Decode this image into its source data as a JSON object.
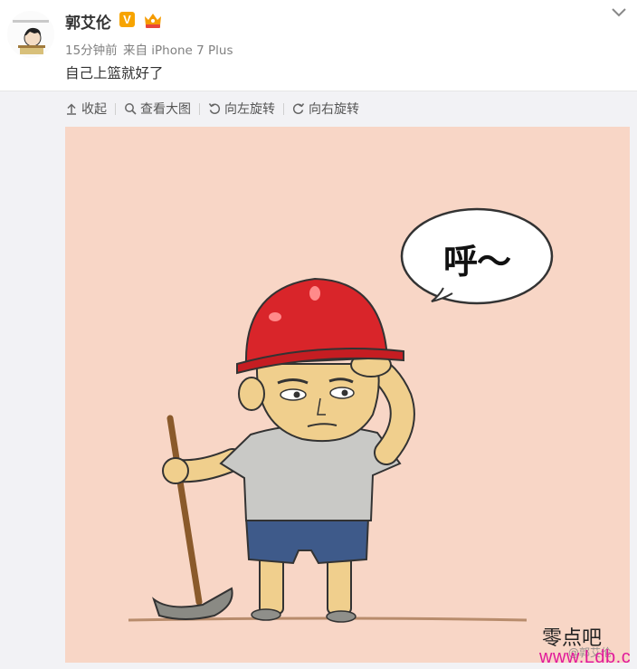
{
  "post": {
    "author": "郭艾伦",
    "verified_badge": "V",
    "meta_time": "15分钟前",
    "meta_from": "来自 iPhone 7 Plus",
    "text": "自己上篮就好了"
  },
  "toolbar": {
    "collapse": "收起",
    "view_large": "查看大图",
    "rotate_left": "向左旋转",
    "rotate_right": "向右旋转"
  },
  "image": {
    "speech": "呼～",
    "watermark_cn": "零点吧",
    "watermark_weibo": "@郭艾伦",
    "watermark_url": "www.Ldb.cc"
  },
  "icons": {
    "verified": "verified-v-icon",
    "member": "crown-icon",
    "expand": "chevron-down-icon",
    "collapse": "arrow-up-icon",
    "zoom": "search-icon",
    "rotate_left": "rotate-left-icon",
    "rotate_right": "rotate-right-icon"
  },
  "colors": {
    "verified": "#f7a400",
    "image_background": "#f8d6c6",
    "helmet": "#d9252a",
    "url_watermark": "#e0199b"
  }
}
